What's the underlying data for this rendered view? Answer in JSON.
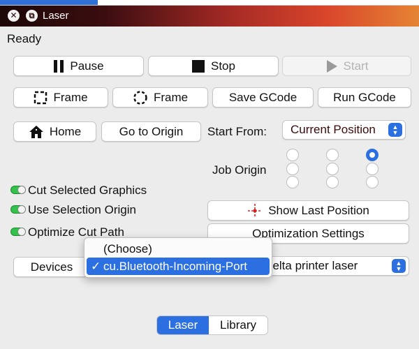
{
  "window": {
    "title": "Laser"
  },
  "status": "Ready",
  "run_controls": {
    "pause": "Pause",
    "stop": "Stop",
    "start": "Start"
  },
  "frame_row": {
    "frame_rect": "Frame",
    "frame_circle": "Frame",
    "save_gcode": "Save GCode",
    "run_gcode": "Run GCode"
  },
  "nav_row": {
    "home": "Home",
    "go_to_origin": "Go to Origin",
    "start_from_label": "Start From:",
    "start_from_value": "Current Position"
  },
  "job_origin": {
    "label": "Job Origin",
    "selected": "top-right"
  },
  "options": {
    "cut_selected_graphics": "Cut Selected Graphics",
    "use_selection_origin": "Use Selection Origin",
    "optimize_cut_path": "Optimize Cut Path",
    "show_last_position": "Show Last Position",
    "optimization_settings": "Optimization Settings"
  },
  "devices": {
    "button": "Devices",
    "device_value": "delta printer laser"
  },
  "port_popup": {
    "options": [
      "(Choose)",
      "cu.Bluetooth-Incoming-Port"
    ],
    "selected": "cu.Bluetooth-Incoming-Port",
    "check_mark": "✓"
  },
  "bottom_tabs": {
    "laser": "Laser",
    "library": "Library",
    "active": "Laser"
  },
  "colors": {
    "accent": "#2b6fe0",
    "toggle_on": "#33c24a",
    "crosshair": "#e02020"
  }
}
